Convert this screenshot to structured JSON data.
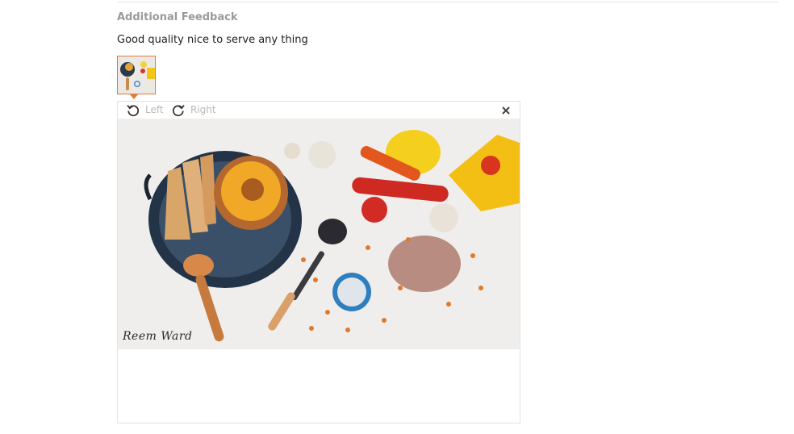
{
  "review": {
    "section_title": "Additional Feedback",
    "feedback_text": "Good quality nice to serve any thing"
  },
  "viewer": {
    "rotate_left_label": "Left",
    "rotate_right_label": "Right",
    "close_icon": "close-icon",
    "photo_signature": "Reem Ward"
  },
  "colors": {
    "accent": "#e07a3d",
    "muted_text": "#9a9a9a",
    "toolbar_text": "#b8b8b8"
  }
}
